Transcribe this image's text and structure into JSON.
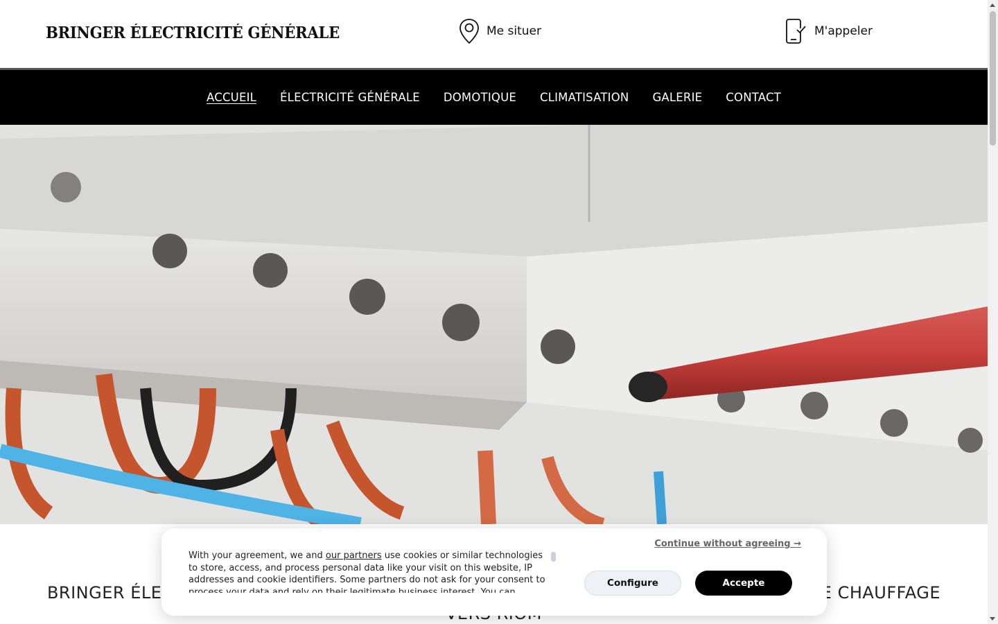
{
  "header": {
    "brand": "BRINGER ÉLECTRICITÉ GÉNÉRALE",
    "locate_label": "Me situer",
    "call_label": "M'appeler",
    "locate_icon": "map-pin-icon",
    "call_icon": "smartphone-check-icon"
  },
  "nav": {
    "items": [
      {
        "label": "ACCUEIL",
        "active": true
      },
      {
        "label": "ÉLECTRICITÉ GÉNÉRALE"
      },
      {
        "label": "DOMOTIQUE"
      },
      {
        "label": "CLIMATISATION"
      },
      {
        "label": "GALERIE"
      },
      {
        "label": "CONTACT"
      }
    ]
  },
  "headline": {
    "line1_start": "BRINGER ÉLECT",
    "line1_end": "DE CHAUFFAGE",
    "line2": "VERS RIOM"
  },
  "cookie": {
    "text_before": "With your agreement, we and ",
    "partners_link": "our partners",
    "text_after": " use cookies or similar technologies to store, access, and process personal data like your visit on this website, IP addresses and cookie identifiers. Some partners do not ask for your consent to process your data and rely on their legitimate business interest. You can",
    "continue_label": "Continue without agreeing →",
    "configure_label": "Configure",
    "accept_label": "Accepte"
  },
  "colors": {
    "nav_background": "#000000",
    "accept_button": "#000000",
    "configure_button": "#eef1f5"
  }
}
